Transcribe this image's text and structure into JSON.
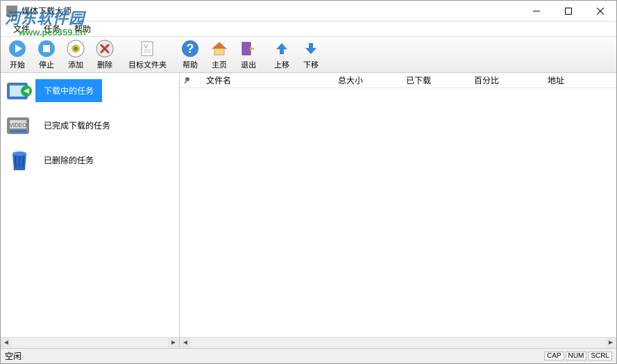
{
  "window": {
    "title": "媒体下载大师"
  },
  "menu": {
    "file": "文件",
    "task": "任务",
    "help": "帮助"
  },
  "toolbar": {
    "start": "开始",
    "stop": "停止",
    "add": "添加",
    "delete": "删除",
    "target_folder": "目标文件夹",
    "help": "帮助",
    "home": "主页",
    "exit": "退出",
    "move_up": "上移",
    "move_down": "下移"
  },
  "sidebar": {
    "items": [
      {
        "label": "下载中的任务",
        "icon": "downloading"
      },
      {
        "label": "已完成下载的任务",
        "icon": "completed"
      },
      {
        "label": "已删除的任务",
        "icon": "deleted"
      }
    ]
  },
  "columns": {
    "filename": "文件名",
    "total_size": "总大小",
    "downloaded": "已下载",
    "percent": "百分比",
    "address": "地址"
  },
  "rows": [],
  "status": {
    "text": "空闲",
    "cap": "CAP",
    "num": "NUM",
    "scrl": "SCRL"
  },
  "watermark": {
    "line1": "河东软件园",
    "line2": "www.pc0359.cn"
  }
}
